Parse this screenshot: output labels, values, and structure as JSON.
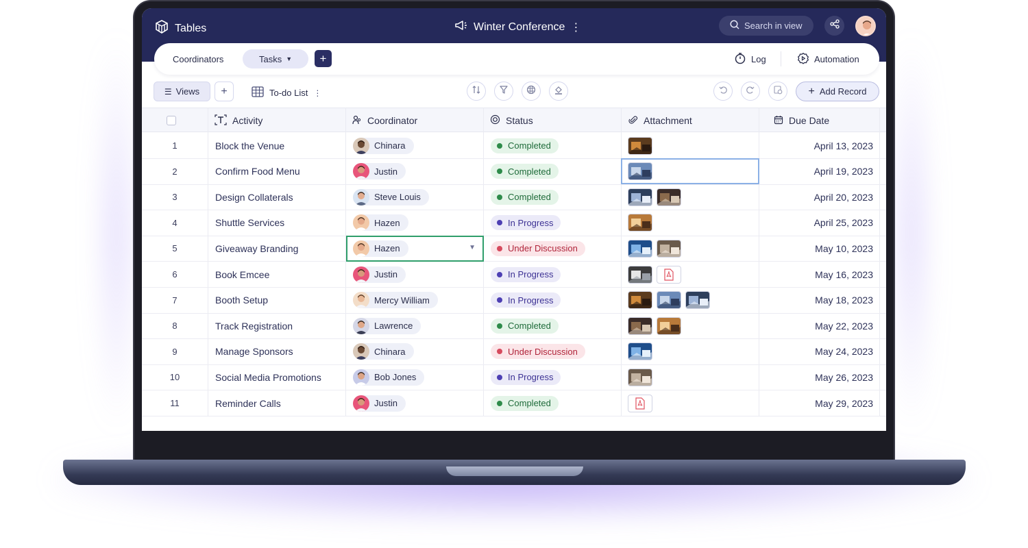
{
  "app": {
    "brand": "Tables",
    "workspace_title": "Winter Conference",
    "search_placeholder": "Search in view"
  },
  "tabs": {
    "items": [
      {
        "label": "Coordinators",
        "active": false
      },
      {
        "label": "Tasks",
        "active": true
      }
    ],
    "right": [
      {
        "label": "Log",
        "icon": "timer-icon"
      },
      {
        "label": "Automation",
        "icon": "gear-icon"
      }
    ]
  },
  "toolbar": {
    "views_label": "Views",
    "view_name": "To-do List",
    "add_record_label": "Add Record"
  },
  "columns": [
    {
      "label": "Activity",
      "icon": "text-icon"
    },
    {
      "label": "Coordinator",
      "icon": "people-icon"
    },
    {
      "label": "Status",
      "icon": "status-icon"
    },
    {
      "label": "Attachment",
      "icon": "paperclip-icon"
    },
    {
      "label": "Due Date",
      "icon": "calendar-icon"
    }
  ],
  "status_colors": {
    "Completed": {
      "bg": "#e4f4e8",
      "fg": "#1f6b3a",
      "dot": "#2e8b4a"
    },
    "In Progress": {
      "bg": "#ebeaf8",
      "fg": "#3d3294",
      "dot": "#4d3fb3"
    },
    "Under Discussion": {
      "bg": "#fbe5e8",
      "fg": "#b0243a",
      "dot": "#d64a5d"
    }
  },
  "rows": [
    {
      "num": "1",
      "activity": "Block the Venue",
      "coordinator": "Chinara",
      "status": "Completed",
      "attachments": [
        "photo"
      ],
      "due": "April 13, 2023"
    },
    {
      "num": "2",
      "activity": "Confirm Food Menu",
      "coordinator": "Justin",
      "status": "Completed",
      "attachments": [
        "photo"
      ],
      "due": "April 19, 2023"
    },
    {
      "num": "3",
      "activity": "Design Collaterals",
      "coordinator": "Steve Louis",
      "status": "Completed",
      "attachments": [
        "photo",
        "photo"
      ],
      "due": "April 20, 2023"
    },
    {
      "num": "4",
      "activity": "Shuttle Services",
      "coordinator": "Hazen",
      "status": "In Progress",
      "attachments": [
        "photo"
      ],
      "due": "April 25, 2023"
    },
    {
      "num": "5",
      "activity": "Giveaway Branding",
      "coordinator": "Hazen",
      "status": "Under Discussion",
      "attachments": [
        "photo",
        "photo"
      ],
      "due": "May 10, 2023"
    },
    {
      "num": "6",
      "activity": "Book Emcee",
      "coordinator": "Justin",
      "status": "In Progress",
      "attachments": [
        "photo",
        "pdf"
      ],
      "due": "May 16, 2023"
    },
    {
      "num": "7",
      "activity": "Booth Setup",
      "coordinator": "Mercy William",
      "status": "In Progress",
      "attachments": [
        "photo",
        "photo",
        "photo"
      ],
      "due": "May 18, 2023"
    },
    {
      "num": "8",
      "activity": "Track Registration",
      "coordinator": "Lawrence",
      "status": "Completed",
      "attachments": [
        "photo",
        "photo"
      ],
      "due": "May 22, 2023"
    },
    {
      "num": "9",
      "activity": "Manage Sponsors",
      "coordinator": "Chinara",
      "status": "Under Discussion",
      "attachments": [
        "photo"
      ],
      "due": "May 24, 2023"
    },
    {
      "num": "10",
      "activity": "Social Media Promotions",
      "coordinator": "Bob Jones",
      "status": "In Progress",
      "attachments": [
        "photo"
      ],
      "due": "May 26, 2023"
    },
    {
      "num": "11",
      "activity": "Reminder Calls",
      "coordinator": "Justin",
      "status": "Completed",
      "attachments": [
        "pdf"
      ],
      "due": "May 29, 2023"
    }
  ]
}
